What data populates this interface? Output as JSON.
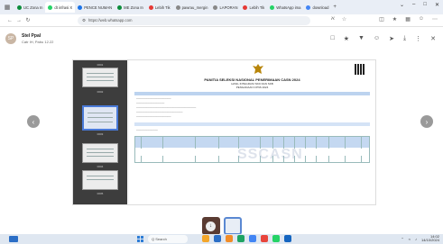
{
  "browser": {
    "tabs": [
      {
        "label": "UC Zona In",
        "active": false,
        "color": "#0b8d3b"
      },
      {
        "label": "dt infrasi X",
        "active": true,
        "color": "#25d366"
      },
      {
        "label": "PENCE NUMAN",
        "active": false,
        "color": "#1a73e8"
      },
      {
        "label": "ME Zona In",
        "active": false,
        "color": "#0b8d3b"
      },
      {
        "label": "Lebih Tik",
        "active": false,
        "color": "#e53935"
      },
      {
        "label": "pawrau_mergin",
        "active": false,
        "color": "#888888"
      },
      {
        "label": "LAPORAN",
        "active": false,
        "color": "#888888"
      },
      {
        "label": "Lebih Tik",
        "active": false,
        "color": "#e53935"
      },
      {
        "label": "WhatsApp ima",
        "active": false,
        "color": "#25d366"
      },
      {
        "label": "download",
        "active": false,
        "color": "#4285f4"
      }
    ],
    "url": "https://web.whatsapp.com"
  },
  "viewer": {
    "sender_name": "Stel Ppal",
    "sender_date": "Catr IH, Pabu 12.22",
    "avatar_letter": "SP"
  },
  "document": {
    "title": "PANITIA SELEKSI NASIONAL PENERIMAAN CASN 2024",
    "subtitle1": "HASIL INTEGRASI SKD DAN SKB",
    "subtitle2": "PENGADAAN CPNS 2024",
    "watermark": "SSCASN",
    "thumb_labels": [
      "0001",
      "0002",
      "0003",
      "0004",
      "0005",
      "0006"
    ]
  },
  "taskbar": {
    "search_placeholder": "Q  Search",
    "time": "14:02",
    "date": "14/10/2024"
  }
}
